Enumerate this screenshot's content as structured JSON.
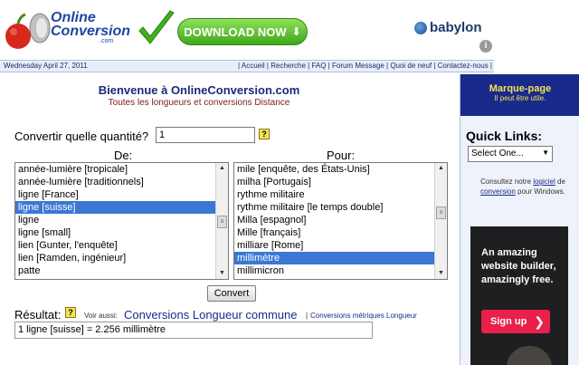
{
  "header": {
    "logo_line1": "Online",
    "logo_line2": "Conversion",
    "logo_com": ".com",
    "download_label": "DOWNLOAD NOW",
    "babylon_label": "babylon"
  },
  "nav": {
    "date": "Wednesday April 27, 2011",
    "links": [
      "Accueil",
      "Recherche",
      "FAQ",
      "Forum Message",
      "Quoi de neuf",
      "Contactez-nous"
    ]
  },
  "main": {
    "title": "Bienvenue à OnlineConversion.com",
    "subtitle": "Toutes les longueurs et conversions Distance",
    "qty_label": "Convertir quelle quantité?",
    "qty_value": "1",
    "from_label": "De:",
    "to_label": "Pour:",
    "from_items": [
      "année-lumière [tropicale]",
      "année-lumière [traditionnels]",
      "ligne [France]",
      "ligne [suisse]",
      "ligne",
      "ligne [small]",
      "lien [Gunter, l'enquête]",
      "lien [Ramden, ingénieur]",
      "patte"
    ],
    "from_selected": 3,
    "to_items": [
      "mile [enquête, des États-Unis]",
      "milha [Portugais]",
      "rythme militaire",
      "rythme militaire [le temps double]",
      "Milla [espagnol]",
      "Mille [français]",
      "milliare [Rome]",
      "millimètre",
      "millimicron"
    ],
    "to_selected": 7,
    "convert_label": "Convert",
    "result_label": "Résultat:",
    "voir_aussi": "Voir aussi:",
    "conv_link": "Conversions Longueur commune",
    "conv_link2": "Conversions métriques Longueur",
    "result_value": "1 ligne [suisse] = 2.256 millimètre"
  },
  "sidebar": {
    "marque_title": "Marque-page",
    "marque_sub": "Il peut être utile.",
    "quick_links": "Quick Links:",
    "select_value": "Select One...",
    "consult_pre": "Consultez notre ",
    "consult_link1": "logiciel",
    "consult_mid": " de ",
    "consult_link2": "conversion",
    "consult_post": " pour Windows."
  },
  "ad": {
    "line1": "An amazing",
    "line2": "website builder,",
    "line3": "amazingly free.",
    "signup": "Sign up"
  },
  "icons": [
    "apple-icon",
    "checkmark-icon",
    "download-arrow-icon",
    "babylon-globe-icon",
    "info-icon",
    "help-icon"
  ],
  "colors": {
    "accent": "#1a2a8a",
    "selection": "#3a78d4",
    "download": "#3ea81b",
    "signup": "#e8204a"
  }
}
